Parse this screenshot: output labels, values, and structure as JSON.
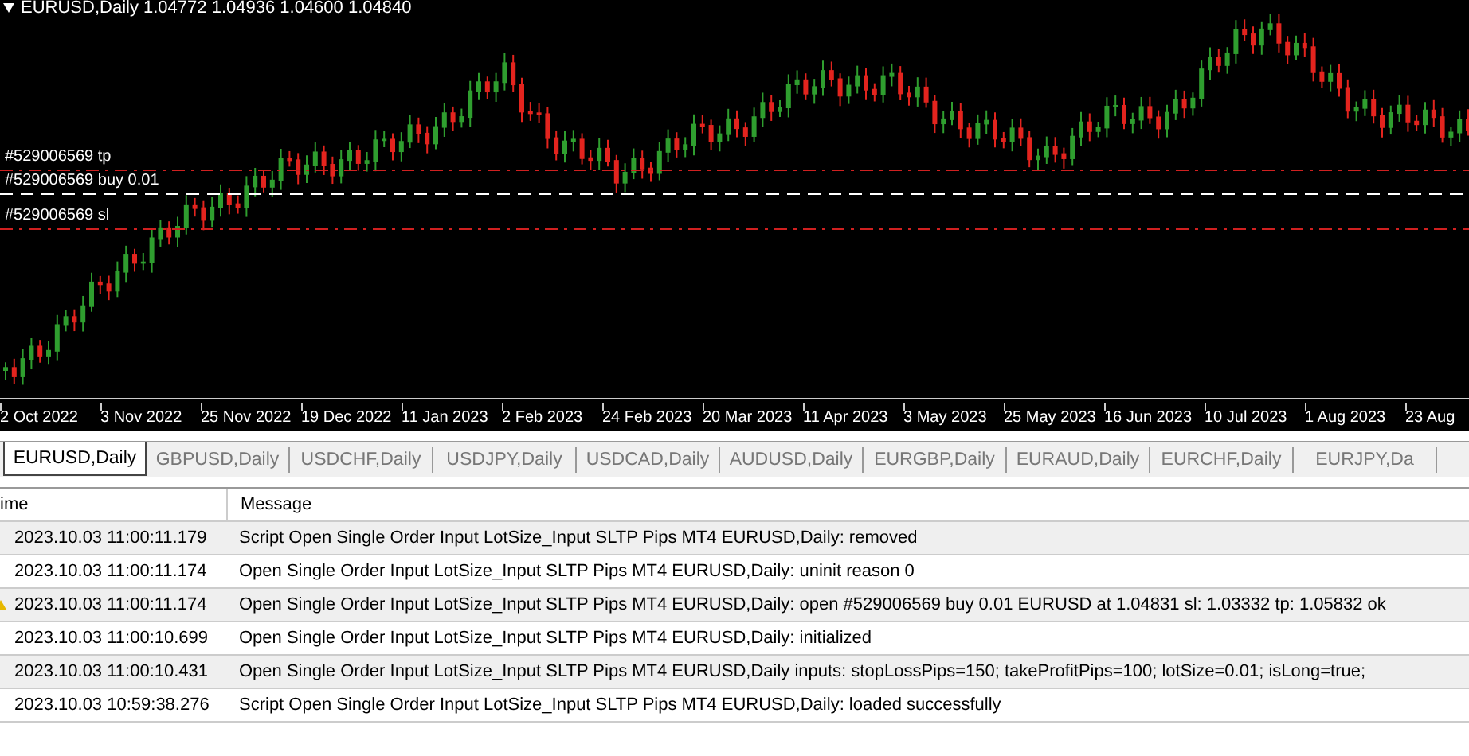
{
  "chart": {
    "title": "EURUSD,Daily  1.04772 1.04936 1.04600 1.04840",
    "order_lines": [
      {
        "kind": "tp",
        "label": "#529006569 tp"
      },
      {
        "kind": "entry",
        "label": "#529006569 buy 0.01"
      },
      {
        "kind": "sl",
        "label": "#529006569 sl"
      }
    ],
    "x_axis_labels": [
      "2 Oct 2022",
      "3 Nov 2022",
      "25 Nov 2022",
      "19 Dec 2022",
      "11 Jan 2023",
      "2 Feb 2023",
      "24 Feb 2023",
      "20 Mar 2023",
      "11 Apr 2023",
      "3 May 2023",
      "25 May 2023",
      "16 Jun 2023",
      "10 Jul 2023",
      "1 Aug 2023",
      "23 Aug"
    ]
  },
  "tabs": [
    {
      "label": "EURUSD,Daily",
      "selected": true
    },
    {
      "label": "GBPUSD,Daily",
      "selected": false
    },
    {
      "label": "USDCHF,Daily",
      "selected": false
    },
    {
      "label": "USDJPY,Daily",
      "selected": false
    },
    {
      "label": "USDCAD,Daily",
      "selected": false
    },
    {
      "label": "AUDUSD,Daily",
      "selected": false
    },
    {
      "label": "EURGBP,Daily",
      "selected": false
    },
    {
      "label": "EURAUD,Daily",
      "selected": false
    },
    {
      "label": "EURCHF,Daily",
      "selected": false
    },
    {
      "label": "EURJPY,Da",
      "selected": false
    }
  ],
  "log": {
    "columns": [
      "ime",
      "Message"
    ],
    "rows": [
      {
        "time": "2023.10.03 11:00:11.179",
        "message": "Script Open Single Order Input LotSize_Input SLTP Pips MT4 EURUSD,Daily: removed",
        "warning": false
      },
      {
        "time": "2023.10.03 11:00:11.174",
        "message": "Open Single Order Input LotSize_Input SLTP Pips MT4 EURUSD,Daily: uninit reason 0",
        "warning": false
      },
      {
        "time": "2023.10.03 11:00:11.174",
        "message": "Open Single Order Input LotSize_Input SLTP Pips MT4 EURUSD,Daily: open #529006569 buy 0.01 EURUSD at 1.04831 sl: 1.03332 tp: 1.05832 ok",
        "warning": true
      },
      {
        "time": "2023.10.03 11:00:10.699",
        "message": "Open Single Order Input LotSize_Input SLTP Pips MT4 EURUSD,Daily: initialized",
        "warning": false
      },
      {
        "time": "2023.10.03 11:00:10.431",
        "message": "Open Single Order Input LotSize_Input SLTP Pips MT4 EURUSD,Daily inputs: stopLossPips=150; takeProfitPips=100; lotSize=0.01; isLong=true;",
        "warning": false
      },
      {
        "time": "2023.10.03 10:59:38.276",
        "message": "Script Open Single Order Input LotSize_Input SLTP Pips MT4 EURUSD,Daily: loaded successfully",
        "warning": false
      }
    ]
  }
}
